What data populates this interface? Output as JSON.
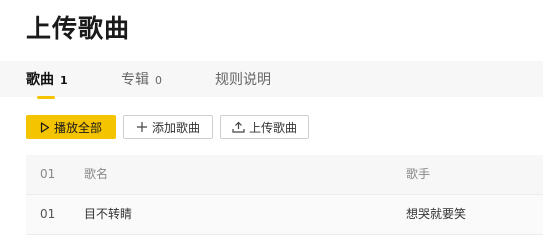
{
  "page": {
    "title": "上传歌曲"
  },
  "tabs": [
    {
      "label": "歌曲",
      "count": "1",
      "active": true
    },
    {
      "label": "专辑",
      "count": "0",
      "active": false
    },
    {
      "label": "规则说明",
      "count": "",
      "active": false
    }
  ],
  "toolbar": {
    "play_all": "播放全部",
    "add_song": "添加歌曲",
    "upload_song": "上传歌曲"
  },
  "table": {
    "columns": {
      "no": "01",
      "name": "歌名",
      "artist": "歌手"
    },
    "rows": [
      {
        "no": "01",
        "name": "目不转睛",
        "artist": "想哭就要笑"
      }
    ]
  },
  "colors": {
    "accent": "#f5c400",
    "band": "#f7f7f7"
  },
  "icons": {
    "play": "play-outline-icon",
    "add": "plus-icon",
    "upload": "upload-icon"
  }
}
